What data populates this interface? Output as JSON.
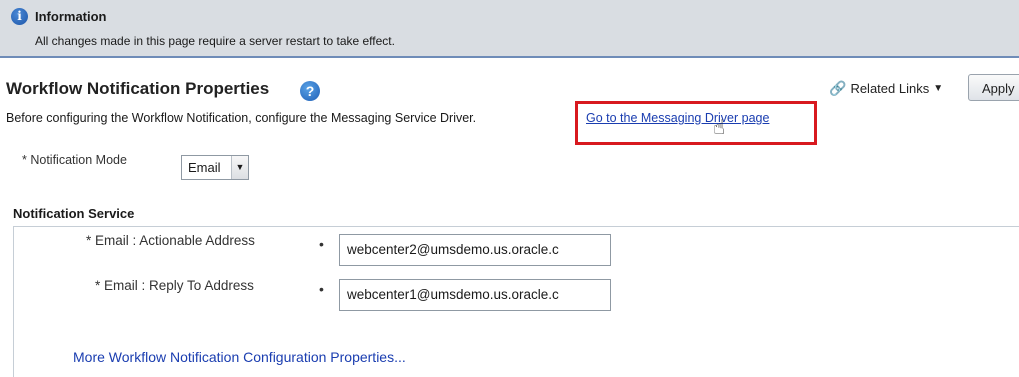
{
  "info": {
    "title": "Information",
    "message": "All changes made in this page require a server restart to take effect."
  },
  "page": {
    "title": "Workflow Notification Properties",
    "help_glyph": "?",
    "related_links": "Related Links",
    "apply_label": "Apply",
    "instruction": "Before configuring the Workflow Notification, configure the Messaging Service Driver.",
    "driver_link": "Go to the Messaging Driver page"
  },
  "notification_mode": {
    "required_mark": "*",
    "label": "Notification Mode",
    "value": "Email"
  },
  "notification_service": {
    "title": "Notification Service",
    "fields": [
      {
        "required_mark": "*",
        "label": "Email : Actionable Address",
        "dot": "•",
        "value": "webcenter2@umsdemo.us.oracle.c"
      },
      {
        "required_mark": "*",
        "label": "Email : Reply To Address",
        "dot": "•",
        "value": "webcenter1@umsdemo.us.oracle.c"
      }
    ]
  },
  "more_link": "More Workflow Notification Configuration Properties...",
  "colors": {
    "highlight": "#d8191f",
    "link": "#1a3db0",
    "info_background": "#d9dde2"
  }
}
